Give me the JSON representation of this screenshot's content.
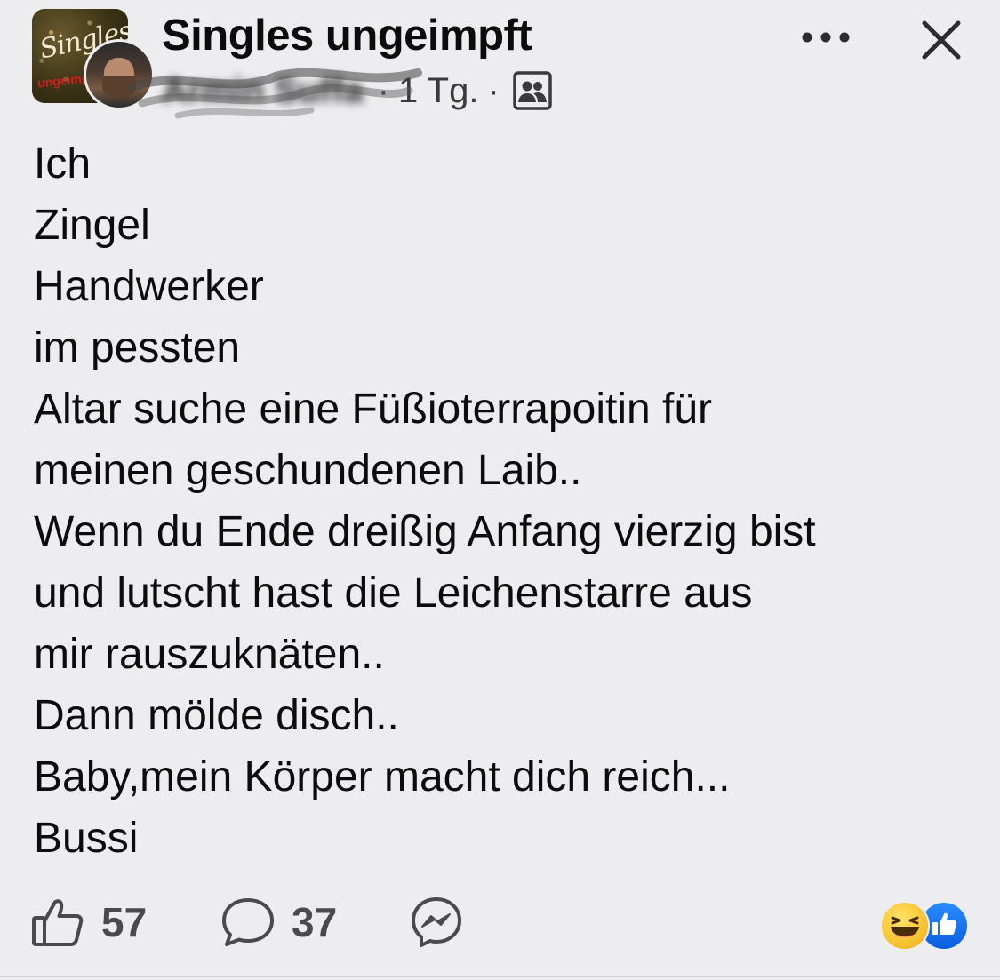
{
  "header": {
    "group_name": "Singles ungeimpft",
    "author_name": "Armin Suffa",
    "time": "1 Tg.",
    "separator": "·",
    "group_logo_text": "Singles",
    "group_logo_sub": "ungeimpft",
    "privacy_icon": "group-members-icon",
    "more_icon": "more-horizontal-icon",
    "close_icon": "close-icon"
  },
  "post": {
    "lines": [
      "Ich",
      "Zingel",
      "Handwerker",
      "im pessten",
      "Altar suche eine Füßioterrapoitin für",
      "meinen geschundenen Laib..",
      "Wenn du Ende dreißig Anfang vierzig bist",
      "und lutscht hast die Leichenstarre aus",
      "mir rauszuknäten..",
      "Dann mölde disch..",
      "Baby,mein Körper macht dich reich...",
      "Bussi"
    ]
  },
  "footer": {
    "likes": "57",
    "comments": "37",
    "like_icon": "thumbs-up-icon",
    "comment_icon": "comment-bubble-icon",
    "share_icon": "messenger-icon",
    "reactions": [
      "haha-reaction-icon",
      "like-reaction-icon"
    ]
  },
  "colors": {
    "background": "#ededef",
    "text": "#0c0c0d",
    "secondary_text": "#4a4a4c",
    "like_blue": "#0a5fe0",
    "haha_yellow": "#f7c331"
  }
}
